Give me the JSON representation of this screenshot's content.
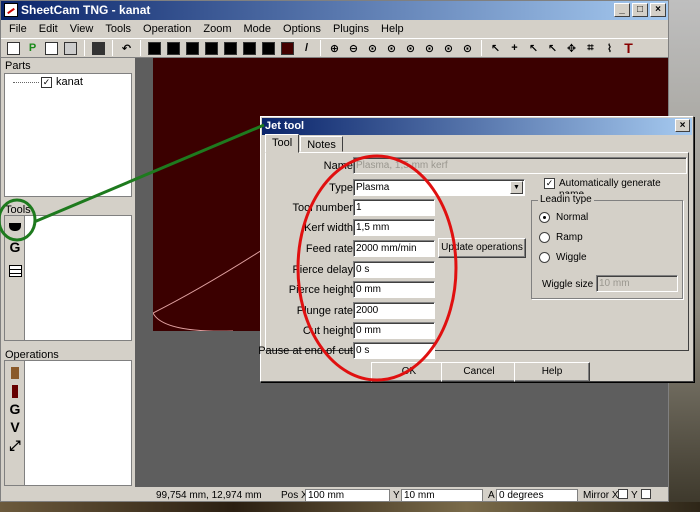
{
  "window": {
    "title": "SheetCam TNG - kanat",
    "controls": {
      "minimize": "_",
      "maximize": "□",
      "close": "×"
    }
  },
  "menu": [
    "File",
    "Edit",
    "View",
    "Tools",
    "Operation",
    "Zoom",
    "Mode",
    "Options",
    "Plugins",
    "Help"
  ],
  "toolbar": {
    "letters": {
      "post": "P",
      "text_tool": "T"
    }
  },
  "panels": {
    "parts_label": "Parts",
    "parts_item": "kanat",
    "parts_item_checked": "✓",
    "tools_label": "Tools",
    "operations_label": "Operations",
    "tool_icons": [
      "G"
    ],
    "op_icons": [
      "G",
      "V"
    ]
  },
  "status": {
    "coords": "99,754 mm, 12,974 mm",
    "pos_x_label": "Pos X",
    "pos_x": "100 mm",
    "y_label": "Y",
    "y": "10 mm",
    "angle_label": "A",
    "angle": "0 degrees",
    "mirror_x_label": "Mirror X",
    "mirror_y_label": "Y"
  },
  "dialog": {
    "title": "Jet tool",
    "close": "×",
    "tabs": [
      "Tool",
      "Notes"
    ],
    "fields": {
      "name_label": "Name",
      "name_value": "Plasma, 1,5 mm kerf",
      "type_label": "Type",
      "type_value": "Plasma",
      "tool_number_label": "Tool number",
      "tool_number": "1",
      "kerf_width_label": "Kerf width",
      "kerf_width": "1,5 mm",
      "feed_rate_label": "Feed rate",
      "feed_rate": "2000 mm/min",
      "pierce_delay_label": "Pierce delay",
      "pierce_delay": "0 s",
      "pierce_height_label": "Pierce height",
      "pierce_height": "0 mm",
      "plunge_rate_label": "Plunge rate",
      "plunge_rate": "2000",
      "cut_height_label": "Cut height",
      "cut_height": "0 mm",
      "pause_label": "Pause at end of cut",
      "pause": "0 s"
    },
    "update_button": "Update operations",
    "auto_name_label": "Automatically generate name",
    "auto_name_checked": "✓",
    "leadin": {
      "title": "Leadin type",
      "options": [
        "Normal",
        "Ramp",
        "Wiggle"
      ],
      "wiggle_size_label": "Wiggle size",
      "wiggle_size": "10 mm"
    },
    "buttons": {
      "ok": "OK",
      "cancel": "Cancel",
      "help": "Help"
    }
  },
  "colors": {
    "annotation_red": "#e01010",
    "annotation_green": "#1e7a1e",
    "drawing_bg": "#3b0000"
  }
}
